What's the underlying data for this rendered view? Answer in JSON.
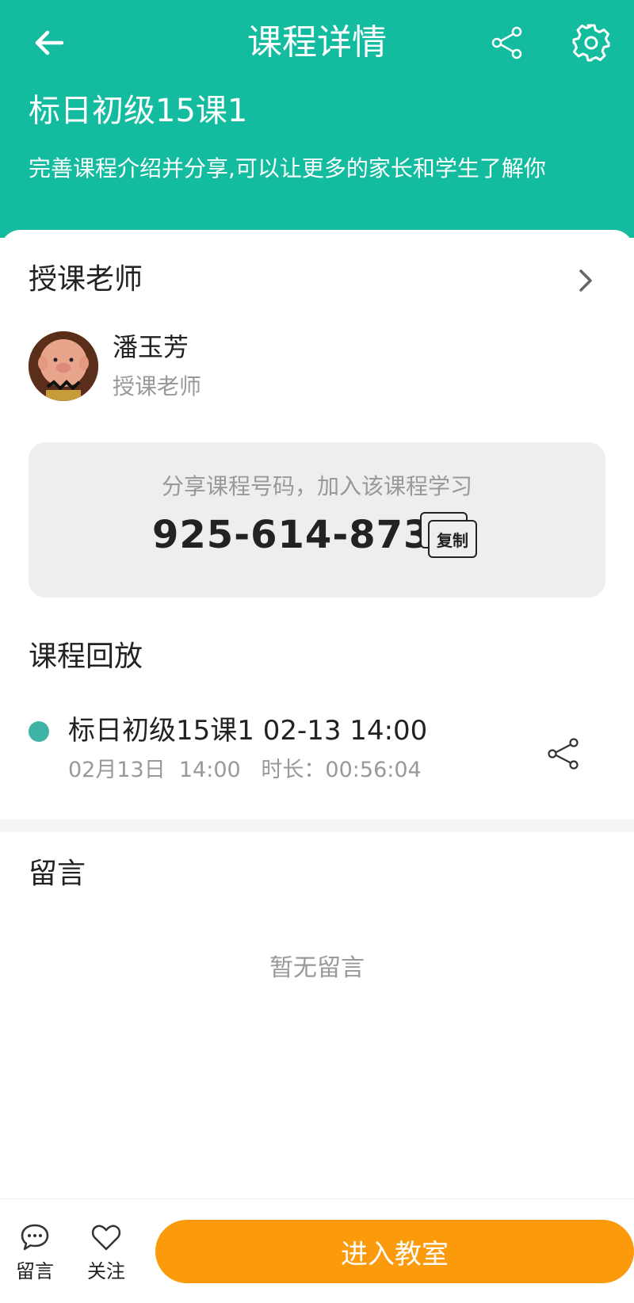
{
  "header": {
    "title": "课程详情",
    "course_name": "标日初级15课1",
    "intro": "完善课程介绍并分享,可以让更多的家长和学生了解你",
    "back_icon": "arrow-left-icon",
    "share_icon": "share-icon",
    "settings_icon": "gear-icon",
    "background_color": "#13bb9f"
  },
  "teacher": {
    "section_title": "授课老师",
    "name": "潘玉芳",
    "role": "授课老师",
    "avatar_icon": "cartoon-avatar"
  },
  "course_code": {
    "hint": "分享课程号码，加入该课程学习",
    "code": "925-614-873",
    "copy_label": "复制"
  },
  "replay": {
    "section_title": "课程回放",
    "items": [
      {
        "title": "标日初级15课1 02-13 14:00",
        "meta": "02月13日  14:00   时长：00:56:04",
        "dot_color": "#3fb4a6"
      }
    ]
  },
  "comments": {
    "section_title": "留言",
    "empty_text": "暂无留言"
  },
  "bottom_bar": {
    "comment_label": "留言",
    "follow_label": "关注",
    "enter_label": "进入教室",
    "enter_color": "#fb9a0b"
  }
}
